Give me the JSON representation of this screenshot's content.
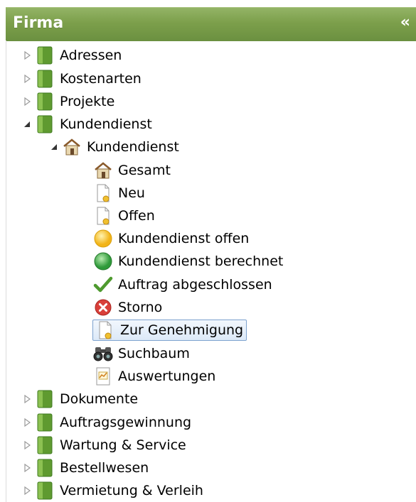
{
  "panel": {
    "title": "Firma",
    "collapse_glyph": "«"
  },
  "tree": [
    {
      "label": "Adressen",
      "icon": "folder-icon",
      "expanded": false
    },
    {
      "label": "Kostenarten",
      "icon": "folder-icon",
      "expanded": false
    },
    {
      "label": "Projekte",
      "icon": "folder-icon",
      "expanded": false
    },
    {
      "label": "Kundendienst",
      "icon": "folder-icon",
      "expanded": true
    },
    {
      "label": "Kundendienst",
      "icon": "house-icon",
      "expanded": true
    },
    {
      "label": "Gesamt",
      "icon": "house-icon"
    },
    {
      "label": "Neu",
      "icon": "document-icon"
    },
    {
      "label": "Offen",
      "icon": "document-icon"
    },
    {
      "label": "Kundendienst offen",
      "icon": "yellow-circle-icon"
    },
    {
      "label": "Kundendienst berechnet",
      "icon": "green-circle-icon"
    },
    {
      "label": "Auftrag abgeschlossen",
      "icon": "checkmark-icon"
    },
    {
      "label": "Storno",
      "icon": "cancel-icon"
    },
    {
      "label": "Zur Genehmigung",
      "icon": "document-icon",
      "selected": true
    },
    {
      "label": "Suchbaum",
      "icon": "binoculars-icon"
    },
    {
      "label": "Auswertungen",
      "icon": "chart-document-icon"
    },
    {
      "label": "Dokumente",
      "icon": "folder-icon",
      "expanded": false
    },
    {
      "label": "Auftragsgewinnung",
      "icon": "folder-icon",
      "expanded": false
    },
    {
      "label": "Wartung & Service",
      "icon": "folder-icon",
      "expanded": false
    },
    {
      "label": "Bestellwesen",
      "icon": "folder-icon",
      "expanded": false
    },
    {
      "label": "Vermietung & Verleih",
      "icon": "folder-icon",
      "expanded": false
    }
  ],
  "colors": {
    "header": "#7c9f4b",
    "folder": "#6aa33a",
    "selection_border": "#7da2ce"
  }
}
